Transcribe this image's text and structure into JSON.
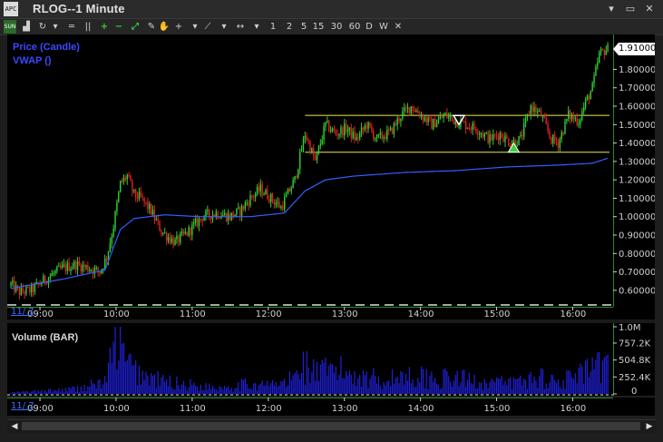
{
  "window": {
    "title": "RLOG--1 Minute",
    "app_icon_text": "APC",
    "controls": [
      "▾",
      "▭",
      "✕"
    ]
  },
  "toolbar": {
    "items": [
      {
        "name": "sun-toggle",
        "label": "SUN",
        "icon": "sun-icon"
      },
      {
        "name": "chart-type",
        "label": "▟",
        "icon": "bar-chart-icon"
      },
      {
        "name": "refresh",
        "label": "↻",
        "icon": "refresh-icon"
      },
      {
        "name": "dropdown",
        "label": "▾",
        "icon": "chevron-down-icon"
      },
      {
        "name": "lines",
        "label": "═",
        "icon": "lines-icon"
      },
      {
        "name": "columns",
        "label": "||",
        "icon": "columns-icon"
      },
      {
        "name": "zoom-in",
        "label": "+",
        "icon": "plus-icon"
      },
      {
        "name": "zoom-out",
        "label": "−",
        "icon": "minus-icon"
      },
      {
        "name": "fit",
        "label": "⤢",
        "icon": "fit-icon"
      },
      {
        "name": "pencil",
        "label": "✎",
        "icon": "pencil-icon"
      },
      {
        "name": "hand",
        "label": "✋",
        "icon": "hand-icon"
      },
      {
        "name": "crosshair",
        "label": "+",
        "icon": "crosshair-icon"
      },
      {
        "name": "dropdown2",
        "label": "▾",
        "icon": "chevron-down-icon"
      },
      {
        "name": "line-tool",
        "label": "⟋",
        "icon": "line-tool-icon"
      },
      {
        "name": "dropdown3",
        "label": "▾",
        "icon": "chevron-down-icon"
      },
      {
        "name": "arrows",
        "label": "↔",
        "icon": "horizontal-arrows-icon"
      },
      {
        "name": "dropdown4",
        "label": "▾",
        "icon": "chevron-down-icon"
      },
      {
        "name": "tf-1",
        "label": "1"
      },
      {
        "name": "tf-2",
        "label": "2"
      },
      {
        "name": "tf-5",
        "label": "5"
      },
      {
        "name": "tf-15",
        "label": "15"
      },
      {
        "name": "tf-30",
        "label": "30"
      },
      {
        "name": "tf-60",
        "label": "60"
      },
      {
        "name": "tf-d",
        "label": "D"
      },
      {
        "name": "tf-w",
        "label": "W"
      },
      {
        "name": "close-tf",
        "label": "✕",
        "icon": "close-icon"
      }
    ]
  },
  "price_pane": {
    "legend": [
      {
        "label": "Price (Candle)",
        "color": "#3b49ff"
      },
      {
        "label": "VWAP ()",
        "color": "#3b49ff"
      }
    ],
    "last_price": "1.91000",
    "y_ticks": [
      "1.80000",
      "1.70000",
      "1.60000",
      "1.50000",
      "1.40000",
      "1.30000",
      "1.20000",
      "1.10000",
      "1.00000",
      "0.90000",
      "0.80000",
      "0.70000",
      "0.60000"
    ],
    "date_label": "11/ 7",
    "time_ticks": [
      "09:00",
      "10:00",
      "11:00",
      "12:00",
      "13:00",
      "14:00",
      "15:00",
      "16:00"
    ]
  },
  "volume_pane": {
    "legend": "Volume (BAR)",
    "y_ticks": [
      "1.0M",
      "757.2K",
      "504.8K",
      "252.4K",
      "0"
    ],
    "date_label": "11/ 7",
    "time_ticks": [
      "09:00",
      "10:00",
      "11:00",
      "12:00",
      "13:00",
      "14:00",
      "15:00",
      "16:00"
    ]
  },
  "colors": {
    "up": "#2fd12f",
    "down": "#e02020",
    "vwap": "#3060ff",
    "volume": "#2020e0",
    "hline": "#e8e860",
    "axis_line": "#2a8a2a"
  },
  "chart_data": {
    "type": "candlestick",
    "price_ylim": [
      0.55,
      1.95
    ],
    "hlines": [
      1.55,
      1.35
    ],
    "anchors_price": [
      [
        0,
        0.63
      ],
      [
        5,
        0.59
      ],
      [
        12,
        0.6
      ],
      [
        20,
        0.66
      ],
      [
        30,
        0.72
      ],
      [
        38,
        0.74
      ],
      [
        46,
        0.72
      ],
      [
        52,
        0.7
      ],
      [
        56,
        0.78
      ],
      [
        60,
        0.95
      ],
      [
        64,
        1.18
      ],
      [
        68,
        1.22
      ],
      [
        72,
        1.12
      ],
      [
        76,
        1.1
      ],
      [
        82,
        1.03
      ],
      [
        88,
        0.92
      ],
      [
        96,
        0.86
      ],
      [
        104,
        0.92
      ],
      [
        112,
        1.0
      ],
      [
        120,
        1.02
      ],
      [
        128,
        1.0
      ],
      [
        134,
        1.03
      ],
      [
        140,
        1.1
      ],
      [
        146,
        1.15
      ],
      [
        152,
        1.1
      ],
      [
        158,
        1.05
      ],
      [
        166,
        1.2
      ],
      [
        172,
        1.45
      ],
      [
        178,
        1.3
      ],
      [
        184,
        1.5
      ],
      [
        190,
        1.45
      ],
      [
        196,
        1.48
      ],
      [
        202,
        1.42
      ],
      [
        208,
        1.5
      ],
      [
        214,
        1.42
      ],
      [
        222,
        1.46
      ],
      [
        228,
        1.55
      ],
      [
        234,
        1.6
      ],
      [
        240,
        1.55
      ],
      [
        246,
        1.5
      ],
      [
        254,
        1.55
      ],
      [
        260,
        1.52
      ],
      [
        266,
        1.5
      ],
      [
        272,
        1.48
      ],
      [
        280,
        1.42
      ],
      [
        286,
        1.45
      ],
      [
        292,
        1.4
      ],
      [
        298,
        1.42
      ],
      [
        304,
        1.6
      ],
      [
        310,
        1.55
      ],
      [
        316,
        1.42
      ],
      [
        320,
        1.4
      ],
      [
        326,
        1.55
      ],
      [
        332,
        1.52
      ],
      [
        336,
        1.62
      ],
      [
        340,
        1.7
      ],
      [
        344,
        1.88
      ],
      [
        348,
        1.91
      ]
    ],
    "anchors_vwap": [
      [
        0,
        0.61
      ],
      [
        30,
        0.66
      ],
      [
        55,
        0.71
      ],
      [
        64,
        0.93
      ],
      [
        72,
        0.99
      ],
      [
        90,
        1.01
      ],
      [
        110,
        1.0
      ],
      [
        140,
        1.0
      ],
      [
        160,
        1.02
      ],
      [
        172,
        1.14
      ],
      [
        184,
        1.2
      ],
      [
        200,
        1.22
      ],
      [
        230,
        1.24
      ],
      [
        260,
        1.25
      ],
      [
        290,
        1.27
      ],
      [
        320,
        1.28
      ],
      [
        340,
        1.29
      ],
      [
        350,
        1.32
      ]
    ],
    "volume_ylim": [
      0,
      1000000
    ],
    "anchors_volume": [
      [
        0,
        20000
      ],
      [
        20,
        40000
      ],
      [
        40,
        80000
      ],
      [
        55,
        180000
      ],
      [
        60,
        600000
      ],
      [
        63,
        900000
      ],
      [
        66,
        500000
      ],
      [
        72,
        350000
      ],
      [
        80,
        250000
      ],
      [
        90,
        180000
      ],
      [
        100,
        150000
      ],
      [
        110,
        120000
      ],
      [
        120,
        100000
      ],
      [
        130,
        120000
      ],
      [
        140,
        150000
      ],
      [
        150,
        130000
      ],
      [
        160,
        160000
      ],
      [
        166,
        250000
      ],
      [
        170,
        450000
      ],
      [
        180,
        300000
      ],
      [
        190,
        350000
      ],
      [
        200,
        300000
      ],
      [
        210,
        250000
      ],
      [
        220,
        200000
      ],
      [
        230,
        280000
      ],
      [
        240,
        250000
      ],
      [
        250,
        220000
      ],
      [
        260,
        230000
      ],
      [
        270,
        200000
      ],
      [
        280,
        180000
      ],
      [
        290,
        150000
      ],
      [
        300,
        200000
      ],
      [
        310,
        250000
      ],
      [
        320,
        180000
      ],
      [
        330,
        250000
      ],
      [
        340,
        350000
      ],
      [
        350,
        400000
      ]
    ],
    "signals": [
      {
        "type": "sell",
        "index": 262,
        "price": 1.51
      },
      {
        "type": "buy",
        "index": 294,
        "price": 1.38
      }
    ]
  }
}
